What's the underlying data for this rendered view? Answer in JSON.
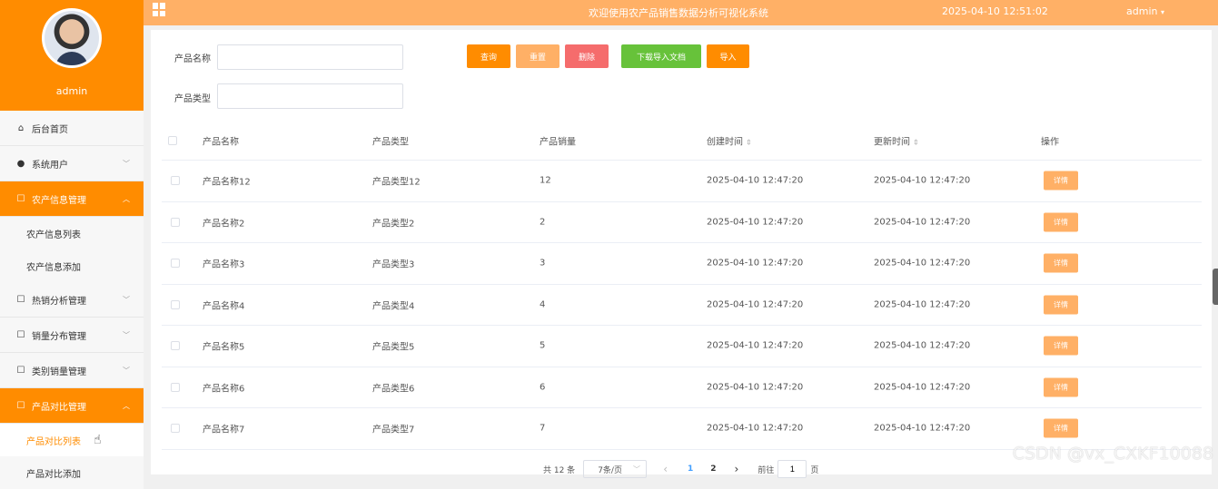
{
  "profile": {
    "name": "admin"
  },
  "topbar": {
    "title": "欢迎使用农产品销售数据分析可视化系统",
    "time": "2025-04-10 12:51:02",
    "user": "admin"
  },
  "sidebar": {
    "items": [
      {
        "label": "后台首页",
        "icon": "home-icon"
      },
      {
        "label": "系统用户",
        "icon": "user-icon"
      },
      {
        "label": "农产信息管理",
        "icon": "doc-edit-icon",
        "sub": [
          "农产信息列表",
          "农产信息添加"
        ]
      },
      {
        "label": "热销分析管理",
        "icon": "doc-edit-icon"
      },
      {
        "label": "销量分布管理",
        "icon": "doc-edit-icon"
      },
      {
        "label": "类别销量管理",
        "icon": "doc-edit-icon"
      },
      {
        "label": "产品对比管理",
        "icon": "doc-edit-icon",
        "sub": [
          "产品对比列表",
          "产品对比添加"
        ]
      }
    ]
  },
  "form": {
    "name_label": "产品名称",
    "type_label": "产品类型",
    "name_value": "",
    "type_value": ""
  },
  "buttons": {
    "query": "查询",
    "reset": "重置",
    "delete": "删除",
    "download": "下载导入文档",
    "import": "导入"
  },
  "colors": {
    "accent": "#ff8c00",
    "topbar": "#ffb066",
    "reset": "#ffb066",
    "delete": "#f56c6c",
    "download": "#67c23a"
  },
  "table": {
    "headers": [
      "产品名称",
      "产品类型",
      "产品销量",
      "创建时间",
      "更新时间",
      "操作"
    ],
    "rows": [
      [
        "产品名称12",
        "产品类型12",
        "12",
        "2025-04-10 12:47:20",
        "2025-04-10 12:47:20",
        "详情"
      ],
      [
        "产品名称2",
        "产品类型2",
        "2",
        "2025-04-10 12:47:20",
        "2025-04-10 12:47:20",
        "详情"
      ],
      [
        "产品名称3",
        "产品类型3",
        "3",
        "2025-04-10 12:47:20",
        "2025-04-10 12:47:20",
        "详情"
      ],
      [
        "产品名称4",
        "产品类型4",
        "4",
        "2025-04-10 12:47:20",
        "2025-04-10 12:47:20",
        "详情"
      ],
      [
        "产品名称5",
        "产品类型5",
        "5",
        "2025-04-10 12:47:20",
        "2025-04-10 12:47:20",
        "详情"
      ],
      [
        "产品名称6",
        "产品类型6",
        "6",
        "2025-04-10 12:47:20",
        "2025-04-10 12:47:20",
        "详情"
      ],
      [
        "产品名称7",
        "产品类型7",
        "7",
        "2025-04-10 12:47:20",
        "2025-04-10 12:47:20",
        "详情"
      ]
    ]
  },
  "pagination": {
    "total": "共 12 条",
    "page_size": "7条/页",
    "prev": "‹",
    "pages": [
      "1",
      "2"
    ],
    "next": "›",
    "goto_label": "前往",
    "goto_value": "1",
    "page_unit": "页"
  },
  "watermark": "CSDN @vx_CXKF10088"
}
